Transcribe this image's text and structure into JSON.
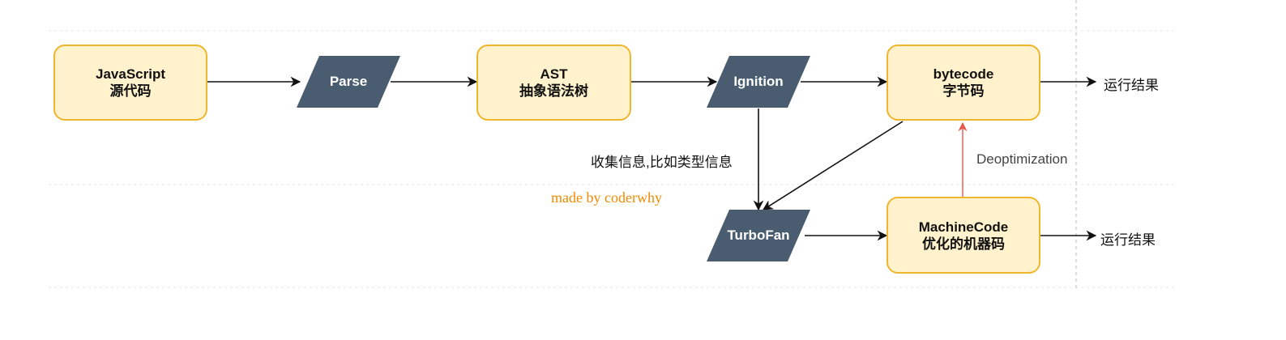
{
  "nodes": {
    "javascript": {
      "line1": "JavaScript",
      "line2": "源代码"
    },
    "parse": {
      "label": "Parse"
    },
    "ast": {
      "line1": "AST",
      "line2": "抽象语法树"
    },
    "ignition": {
      "label": "Ignition"
    },
    "bytecode": {
      "line1": "bytecode",
      "line2": "字节码"
    },
    "turbofan": {
      "label": "TurboFan"
    },
    "machinecode": {
      "line1": "MachineCode",
      "line2": "优化的机器码"
    }
  },
  "edge_labels": {
    "result_top": "运行结果",
    "result_bottom": "运行结果",
    "collect_info": "收集信息,比如类型信息",
    "deopt": "Deoptimization"
  },
  "watermark": "made by coderwhy",
  "colors": {
    "box_fill": "#fff2cc",
    "box_border": "#f0b62e",
    "parallelogram_fill": "#4a5d70",
    "arrow": "#111111",
    "deopt_arrow": "#e8584a",
    "watermark": "#f08a00"
  }
}
